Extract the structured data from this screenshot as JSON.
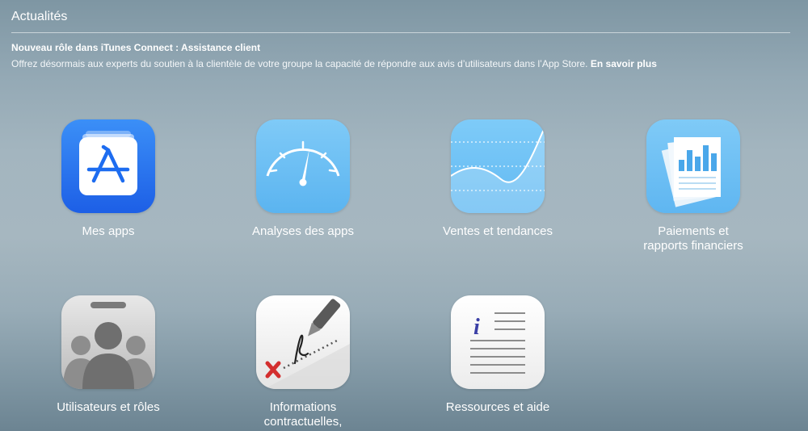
{
  "news": {
    "header": "Actualités",
    "title": "Nouveau rôle dans iTunes Connect : Assistance client",
    "body": "Offrez désormais aux experts du soutien à la clientèle de votre groupe la capacité de répondre aux avis d’utilisateurs dans l’App Store. ",
    "link": "En savoir plus"
  },
  "tiles": [
    {
      "label": "Mes apps",
      "icon": "app-store-icon"
    },
    {
      "label": "Analyses des apps",
      "icon": "gauge-icon"
    },
    {
      "label": "Ventes et tendances",
      "icon": "trend-chart-icon"
    },
    {
      "label": "Paiements et rapports financiers",
      "icon": "financial-reports-icon"
    },
    {
      "label": "Utilisateurs et rôles",
      "icon": "users-badge-icon"
    },
    {
      "label": "Informations contractuelles,",
      "icon": "contract-signature-icon"
    },
    {
      "label": "Ressources et aide",
      "icon": "info-document-icon"
    }
  ],
  "colors": {
    "app_store_blue": "#1f6ff0",
    "light_blue": "#70c1f5",
    "link": "#ffffff"
  }
}
